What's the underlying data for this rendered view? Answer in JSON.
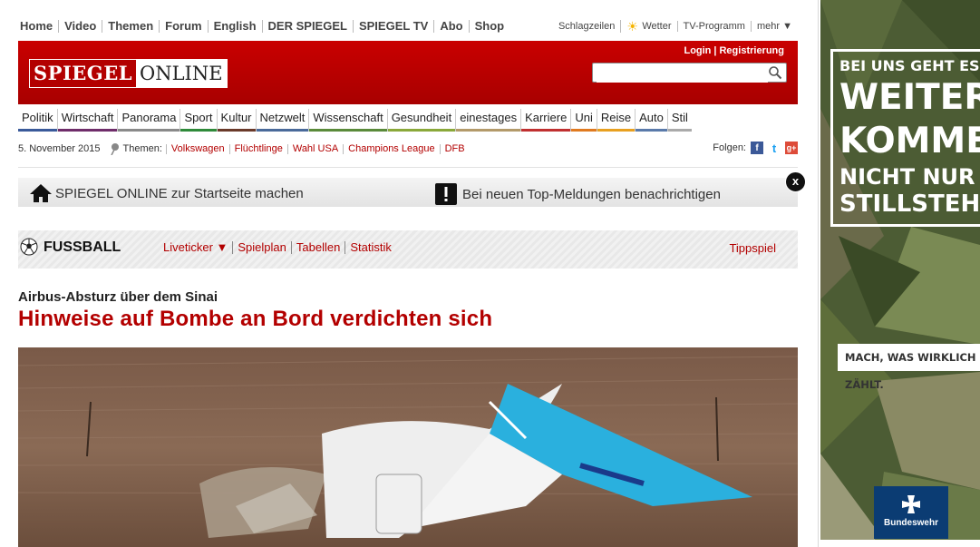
{
  "top_nav": [
    "Home",
    "Video",
    "Themen",
    "Forum",
    "English",
    "DER SPIEGEL",
    "SPIEGEL TV",
    "Abo",
    "Shop"
  ],
  "top_links": {
    "schlagzeilen": "Schlagzeilen",
    "wetter": "Wetter",
    "tv": "TV-Programm",
    "mehr": "mehr ▼"
  },
  "header": {
    "logo_left": "SPIEGEL",
    "logo_right": "ONLINE",
    "login": "Login",
    "register": "Registrierung",
    "search_value": ""
  },
  "categories": [
    {
      "label": "Politik",
      "color": "#3a5a9a"
    },
    {
      "label": "Wirtschaft",
      "color": "#6f2d6a"
    },
    {
      "label": "Panorama",
      "color": "#8a8a8a"
    },
    {
      "label": "Sport",
      "color": "#2f8a3a"
    },
    {
      "label": "Kultur",
      "color": "#6a3a2a"
    },
    {
      "label": "Netzwelt",
      "color": "#4a6a9a"
    },
    {
      "label": "Wissenschaft",
      "color": "#5a8a3a"
    },
    {
      "label": "Gesundheit",
      "color": "#8aa83a"
    },
    {
      "label": "einestages",
      "color": "#b39a6a"
    },
    {
      "label": "Karriere",
      "color": "#c03030"
    },
    {
      "label": "Uni",
      "color": "#e07a20"
    },
    {
      "label": "Reise",
      "color": "#e8a020"
    },
    {
      "label": "Auto",
      "color": "#5a7aaa"
    },
    {
      "label": "Stil",
      "color": "#aaaaaa"
    }
  ],
  "date": "5. November 2015",
  "themen": {
    "label": "Themen:",
    "links": [
      "Volkswagen",
      "Flüchtlinge",
      "Wahl USA",
      "Champions League",
      "DFB"
    ]
  },
  "follow": {
    "label": "Folgen:",
    "facebook": "f",
    "twitter": "t",
    "google": "g+"
  },
  "startbar": {
    "home_text": "SPIEGEL ONLINE zur Startseite machen",
    "notify_text": "Bei neuen Top-Meldungen benachrichtigen",
    "close": "x"
  },
  "fussball": {
    "title": "FUSSBALL",
    "links": [
      "Liveticker ▼",
      "Spielplan",
      "Tabellen",
      "Statistik"
    ],
    "tippspiel": "Tippspiel"
  },
  "article": {
    "kicker": "Airbus-Absturz über dem Sinai",
    "headline": "Hinweise auf Bombe an Bord verdichten sich"
  },
  "ad": {
    "line1": "BEI UNS GEHT ES UMS",
    "line2": "WEITER-",
    "line3": "KOMMEN.",
    "line4": "NICHT NUR UMS",
    "line5": "STILLSTEHEN.",
    "slogan": "MACH, WAS WIRKLICH ZÄHLT.",
    "brand": "Bundeswehr"
  }
}
